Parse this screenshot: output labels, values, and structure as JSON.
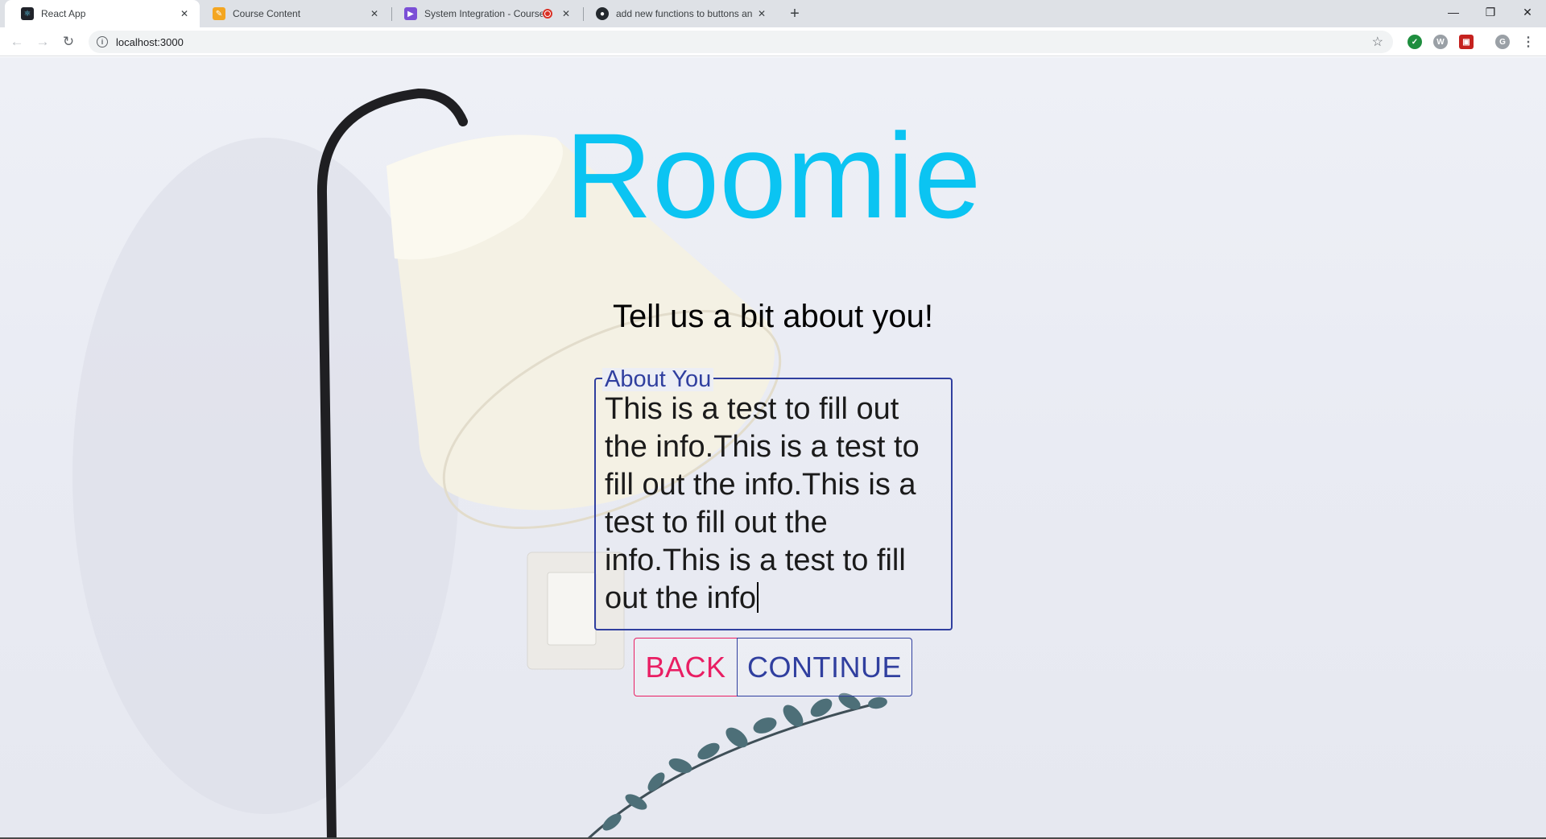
{
  "browser": {
    "tabs": [
      {
        "title": "React App",
        "icon": "react-icon",
        "active": true
      },
      {
        "title": "Course Content",
        "icon": "course-icon",
        "active": false
      },
      {
        "title": "System Integration - Course",
        "icon": "play-icon",
        "active": false
      },
      {
        "title": "add new functions to buttons an",
        "icon": "github-icon",
        "active": false
      }
    ],
    "url": "localhost:3000",
    "profile_initial": "G"
  },
  "page": {
    "brand": "Roomie",
    "subtitle": "Tell us a bit about you!",
    "about": {
      "label": "About You",
      "value": "This is a test to fill out the info.This is a test to fill out the info.This is a test to fill out the info.This is a test to fill out the info"
    },
    "buttons": {
      "back": "BACK",
      "continue": "CONTINUE"
    }
  },
  "colors": {
    "brand": "#0bc4f2",
    "primary": "#303f9f",
    "secondary": "#e91e63"
  }
}
